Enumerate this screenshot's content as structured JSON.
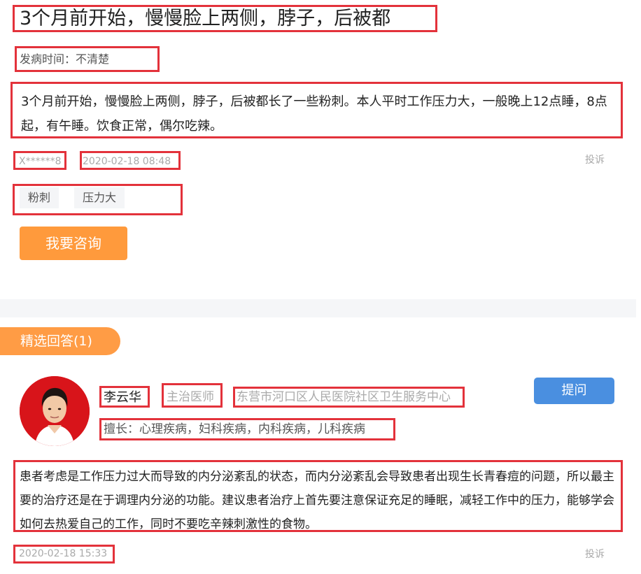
{
  "question": {
    "title": "3个月前开始，慢慢脸上两侧，脖子，后被都",
    "onset_label": "发病时间：",
    "onset_value": "不清楚",
    "description": "3个月前开始，慢慢脸上两侧，脖子，后被都长了一些粉刺。本人平时工作压力大，一般晚上12点睡，8点起，有午睡。饮食正常，偶尔吃辣。",
    "user": "X******8",
    "time": "2020-02-18 08:48",
    "report_label": "投诉",
    "tags": [
      "粉刺",
      "压力大"
    ],
    "consult_button": "我要咨询"
  },
  "answers_section": {
    "tab_label": "精选回答(1)"
  },
  "answer": {
    "doctor_name": "李云华",
    "doctor_title": "主治医师",
    "hospital": "东营市河口区人民医院社区卫生服务中心",
    "specialty": "擅长：心理疾病，妇科疾病，内科疾病，儿科疾病",
    "ask_button": "提问",
    "content": "患者考虑是工作压力过大而导致的内分泌紊乱的状态，而内分泌紊乱会导致患者出现生长青春痘的问题，所以最主要的治疗还是在于调理内分泌的功能。建议患者治疗上首先要注意保证充足的睡眠，减轻工作中的压力，能够学会如何去热爱自己的工作，同时不要吃辛辣刺激性的食物。",
    "time": "2020-02-18 15:33",
    "report_label": "投诉"
  },
  "colors": {
    "highlight_border": "#e3323b",
    "consult_button": "#ff9a3c",
    "ask_button": "#4a8fe0",
    "tab": "#ff9c45"
  }
}
